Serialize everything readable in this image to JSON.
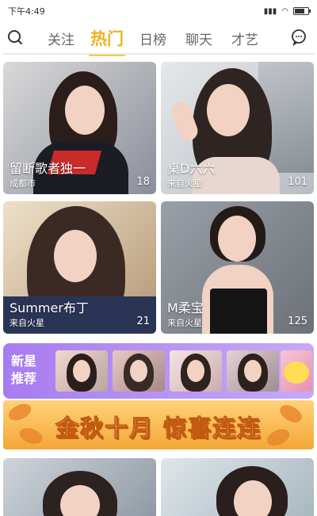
{
  "status_bar": {
    "time": "下午4:49",
    "signal": "4G 4G",
    "wifi": "wifi",
    "battery": "battery-icon"
  },
  "nav": {
    "tabs": [
      {
        "label": "关注"
      },
      {
        "label": "热门"
      },
      {
        "label": "日榜"
      },
      {
        "label": "聊天"
      },
      {
        "label": "才艺"
      }
    ],
    "active_tab": "热门",
    "left_icon": "search-icon",
    "right_icon": "chat-bubble-icon"
  },
  "cards": [
    {
      "name": "留断歌者独一",
      "sub": "成都市",
      "count": "18"
    },
    {
      "name": "桌D六六",
      "sub": "来自火星",
      "count": "101"
    },
    {
      "name": "Summer布丁",
      "sub": "来自火星",
      "count": "21"
    },
    {
      "name": "M柔宝",
      "sub": "来自火星",
      "count": "125"
    }
  ],
  "star_strip": {
    "label": "新星推荐"
  },
  "banner": {
    "text": "金秋十月 惊喜连连"
  },
  "colors": {
    "accent": "#f2b01e",
    "strip": "#a77cf0",
    "banner": "#f3a737"
  }
}
